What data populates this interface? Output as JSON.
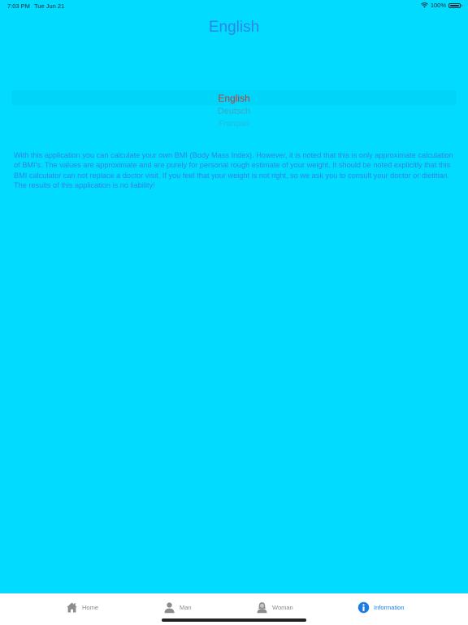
{
  "status_bar": {
    "time": "7:03 PM",
    "date": "Tue Jun 21",
    "battery_text": "100%",
    "battery_level": 1.0
  },
  "header": {
    "title": "English"
  },
  "language_picker": {
    "options": [
      "English",
      "Deutsch",
      "Français"
    ],
    "selected": "English"
  },
  "info": {
    "text": "With this application you can calculate your own BMI (Body Mass Index). However, it is noted that this is only approximate calculation of BMI's. The values are approximate and are purely for personal rough estimate of your weight. It should be noted explicitly that this BMI calculator can not replace a doctor visit. If you feel that your weight is not right, so we ask you to consult your doctor or dietitian. The results of this application is no liability!"
  },
  "tab_bar": {
    "tabs": [
      {
        "label": "Home",
        "icon": "home-icon"
      },
      {
        "label": "Man",
        "icon": "man-icon"
      },
      {
        "label": "Woman",
        "icon": "woman-icon"
      },
      {
        "label": "Information",
        "icon": "info-icon"
      }
    ],
    "active": "Information"
  },
  "colors": {
    "background": "#00dbff",
    "title": "#2f86e6",
    "selected_option": "#c0393b",
    "active_tab": "#1e7be0",
    "inactive_tab": "#8a8a8a"
  }
}
